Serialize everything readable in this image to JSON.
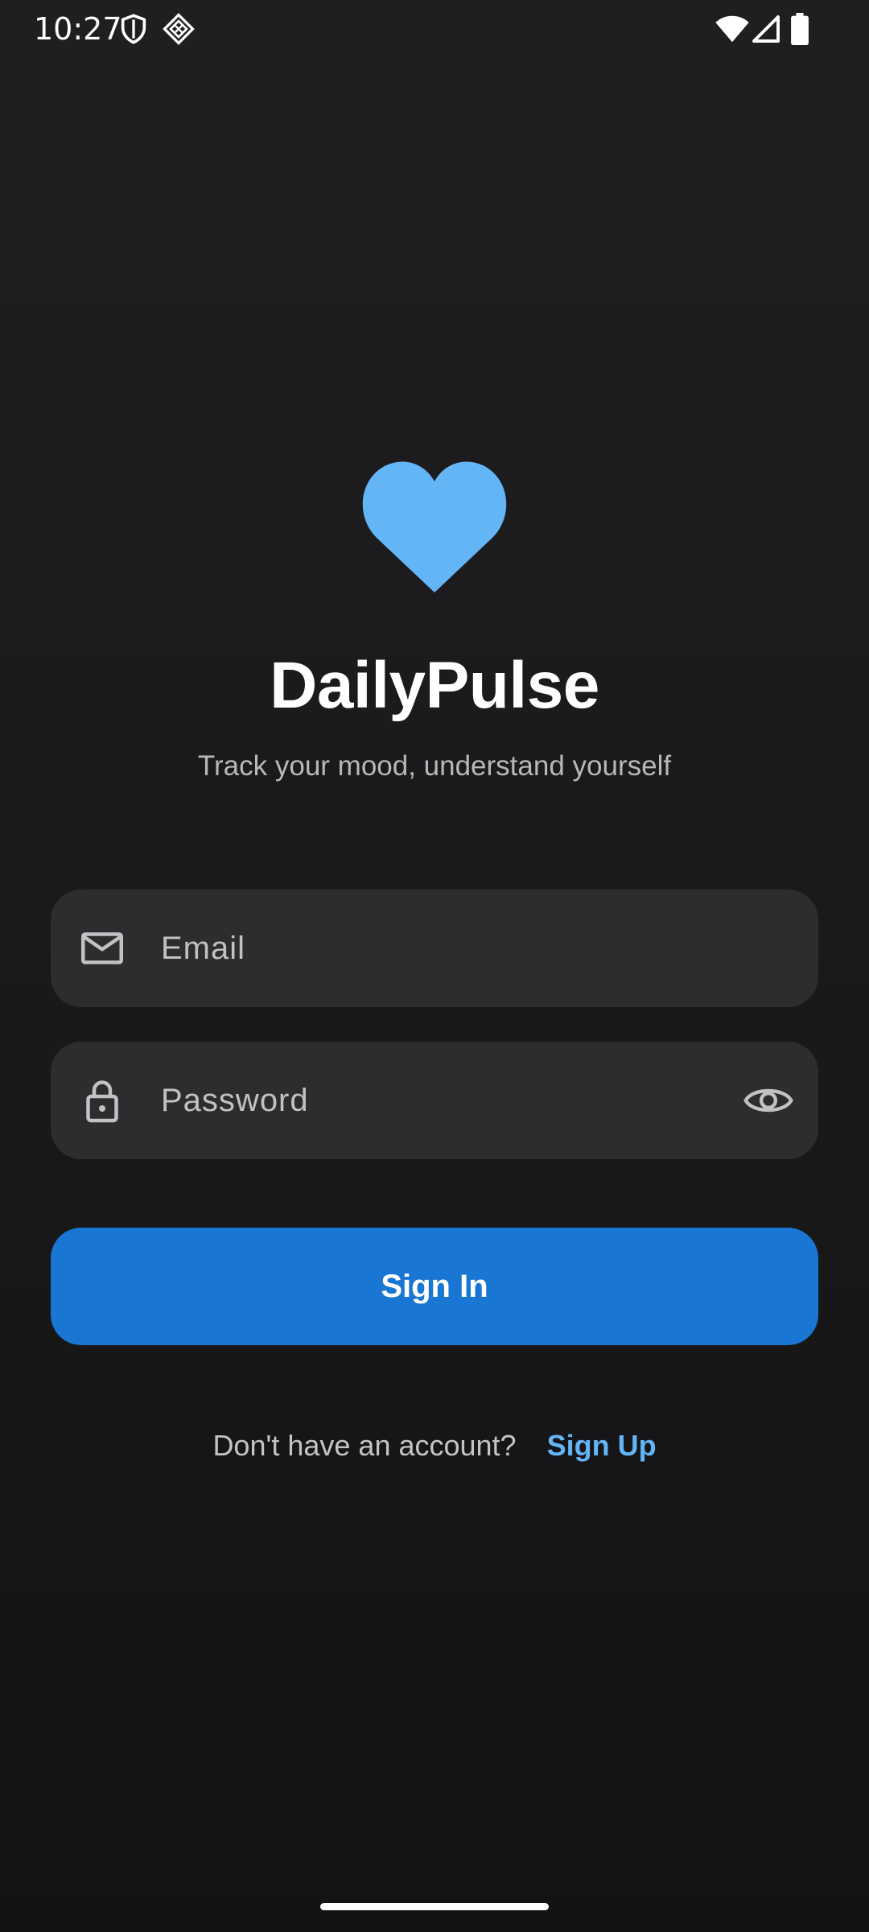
{
  "status_bar": {
    "time": "10:27",
    "left_icons": [
      "shield-icon",
      "notification-diamond-icon"
    ],
    "right_icons": [
      "wifi-icon",
      "cell-signal-icon",
      "battery-icon"
    ]
  },
  "app": {
    "logo_icon": "heart-icon",
    "logo_color": "#64b5f6",
    "title": "DailyPulse",
    "tagline": "Track your mood, understand yourself"
  },
  "form": {
    "email": {
      "icon": "mail-icon",
      "placeholder": "Email",
      "value": ""
    },
    "password": {
      "icon": "lock-icon",
      "placeholder": "Password",
      "value": "",
      "toggle_icon": "eye-icon"
    },
    "sign_in_label": "Sign In",
    "accent_color": "#1976d2"
  },
  "footer": {
    "prompt": "Don't have an account?",
    "sign_up_label": "Sign Up"
  }
}
